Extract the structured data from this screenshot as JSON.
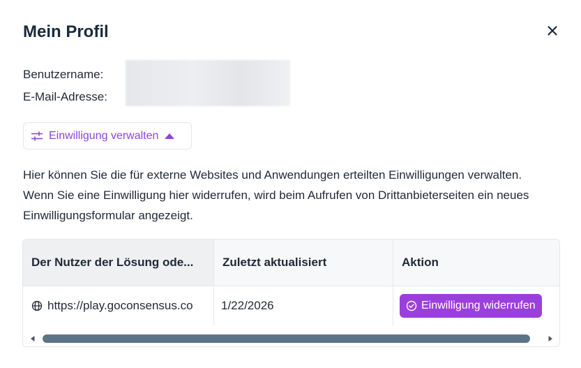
{
  "dialog": {
    "title": "Mein Profil",
    "close_icon": "close-icon"
  },
  "profile": {
    "username_label": "Benutzername:",
    "email_label": "E-Mail-Adresse:"
  },
  "consent_toggle": {
    "label": "Einwilligung verwalten",
    "icon": "sliders-icon",
    "state_icon": "caret-up-icon"
  },
  "description": "Hier können Sie die für externe Websites und Anwendungen erteilten Einwilligungen verwalten. Wenn Sie eine Einwilligung hier widerrufen, wird beim Aufrufen von Drittanbieterseiten ein neues Einwilligungsformular angezeigt.",
  "table": {
    "columns": [
      "Der Nutzer der Lösung ode...",
      "Zuletzt aktualisiert",
      "Aktion"
    ],
    "rows": [
      {
        "site": "https://play.goconsensus.co",
        "updated": "1/22/2026",
        "action_label": "Einwilligung widerrufen"
      }
    ]
  },
  "colors": {
    "accent": "#9b3fdc",
    "accent_text": "#8e44d6",
    "scroll_thumb": "#5b7585"
  }
}
